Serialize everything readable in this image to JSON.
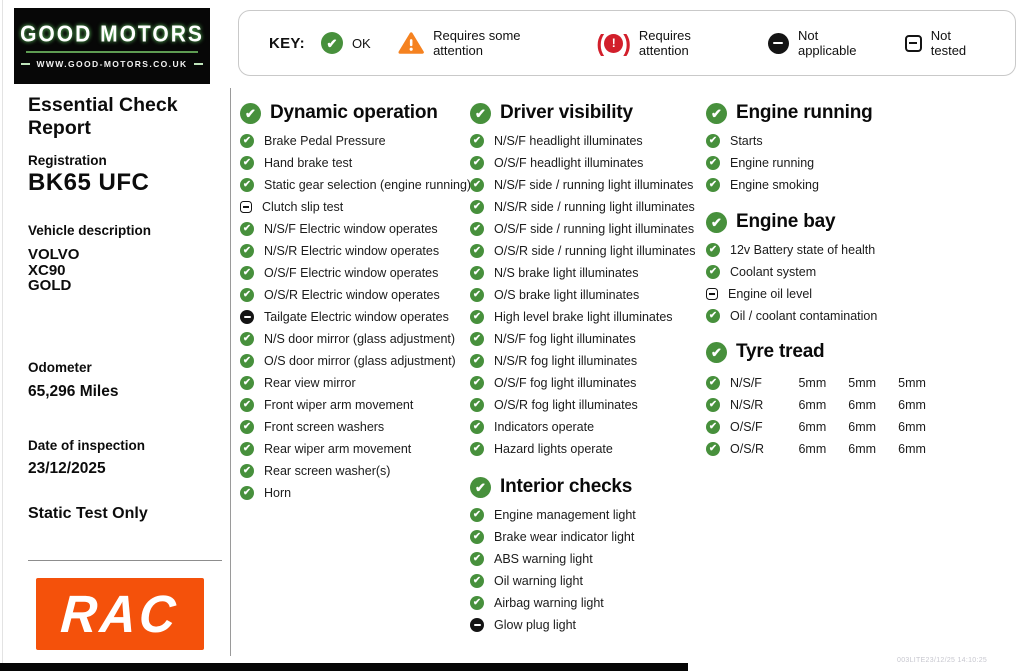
{
  "logo": {
    "title": "GOOD MOTORS",
    "url": "WWW.GOOD-MOTORS.CO.UK"
  },
  "key": {
    "label": "KEY:",
    "items": [
      {
        "icon": "ok-icon",
        "label": "OK"
      },
      {
        "icon": "warning-triangle-icon",
        "label": "Requires some attention"
      },
      {
        "icon": "brake-warning-icon",
        "label": "Requires attention"
      },
      {
        "icon": "not-applicable-icon",
        "label": "Not applicable"
      },
      {
        "icon": "not-tested-icon",
        "label": "Not tested"
      }
    ]
  },
  "sidebar": {
    "report_title": "Essential Check Report",
    "registration_label": "Registration",
    "registration_value": "BK65 UFC",
    "vehicle_label": "Vehicle description",
    "vehicle_lines": [
      "VOLVO",
      "XC90",
      "GOLD"
    ],
    "odometer_label": "Odometer",
    "odometer_value": "65,296 Miles",
    "inspection_label": "Date of inspection",
    "inspection_value": "23/12/2025",
    "test_type": "Static Test Only",
    "rac_logo_text": "RAC"
  },
  "columns": {
    "dynamic_operation": {
      "title": "Dynamic operation",
      "status": "ok",
      "items": [
        {
          "label": "Brake Pedal Pressure",
          "status": "ok"
        },
        {
          "label": "Hand brake test",
          "status": "ok"
        },
        {
          "label": "Static gear selection (engine running)",
          "status": "ok"
        },
        {
          "label": "Clutch slip test",
          "status": "not-tested"
        },
        {
          "label": "N/S/F Electric window operates",
          "status": "ok"
        },
        {
          "label": "N/S/R Electric window operates",
          "status": "ok"
        },
        {
          "label": "O/S/F Electric window operates",
          "status": "ok"
        },
        {
          "label": "O/S/R Electric window operates",
          "status": "ok"
        },
        {
          "label": "Tailgate Electric window operates",
          "status": "not-applicable"
        },
        {
          "label": "N/S door mirror (glass adjustment)",
          "status": "ok"
        },
        {
          "label": "O/S door mirror (glass adjustment)",
          "status": "ok"
        },
        {
          "label": "Rear view mirror",
          "status": "ok"
        },
        {
          "label": "Front wiper arm movement",
          "status": "ok"
        },
        {
          "label": "Front screen washers",
          "status": "ok"
        },
        {
          "label": "Rear wiper arm movement",
          "status": "ok"
        },
        {
          "label": "Rear screen washer(s)",
          "status": "ok"
        },
        {
          "label": "Horn",
          "status": "ok"
        }
      ]
    },
    "driver_visibility": {
      "title": "Driver visibility",
      "status": "ok",
      "items": [
        {
          "label": "N/S/F headlight illuminates",
          "status": "ok"
        },
        {
          "label": "O/S/F headlight illuminates",
          "status": "ok"
        },
        {
          "label": "N/S/F side / running light illuminates",
          "status": "ok"
        },
        {
          "label": "N/S/R side / running light illuminates",
          "status": "ok"
        },
        {
          "label": "O/S/F side / running light illuminates",
          "status": "ok"
        },
        {
          "label": "O/S/R side / running light illuminates",
          "status": "ok"
        },
        {
          "label": "N/S brake light illuminates",
          "status": "ok"
        },
        {
          "label": "O/S brake light illuminates",
          "status": "ok"
        },
        {
          "label": "High level brake light illuminates",
          "status": "ok"
        },
        {
          "label": "N/S/F fog light illuminates",
          "status": "ok"
        },
        {
          "label": "N/S/R fog light illuminates",
          "status": "ok"
        },
        {
          "label": "O/S/F fog light illuminates",
          "status": "ok"
        },
        {
          "label": "O/S/R fog light illuminates",
          "status": "ok"
        },
        {
          "label": "Indicators operate",
          "status": "ok"
        },
        {
          "label": "Hazard lights operate",
          "status": "ok"
        }
      ]
    },
    "interior_checks": {
      "title": "Interior checks",
      "status": "ok",
      "items": [
        {
          "label": "Engine management light",
          "status": "ok"
        },
        {
          "label": "Brake wear indicator light",
          "status": "ok"
        },
        {
          "label": "ABS warning light",
          "status": "ok"
        },
        {
          "label": "Oil warning light",
          "status": "ok"
        },
        {
          "label": "Airbag warning light",
          "status": "ok"
        },
        {
          "label": "Glow plug light",
          "status": "not-applicable"
        }
      ]
    },
    "engine_running": {
      "title": "Engine running",
      "status": "ok",
      "items": [
        {
          "label": "Starts",
          "status": "ok"
        },
        {
          "label": "Engine running",
          "status": "ok"
        },
        {
          "label": "Engine smoking",
          "status": "ok"
        }
      ]
    },
    "engine_bay": {
      "title": "Engine bay",
      "status": "ok",
      "items": [
        {
          "label": "12v Battery state of health",
          "status": "ok"
        },
        {
          "label": "Coolant system",
          "status": "ok"
        },
        {
          "label": "Engine oil level",
          "status": "not-tested"
        },
        {
          "label": "Oil / coolant contamination",
          "status": "ok"
        }
      ]
    },
    "tyre_tread": {
      "title": "Tyre tread",
      "status": "ok",
      "rows": [
        {
          "label": "N/S/F",
          "status": "ok",
          "values": [
            "5mm",
            "5mm",
            "5mm"
          ]
        },
        {
          "label": "N/S/R",
          "status": "ok",
          "values": [
            "6mm",
            "6mm",
            "6mm"
          ]
        },
        {
          "label": "O/S/F",
          "status": "ok",
          "values": [
            "6mm",
            "6mm",
            "6mm"
          ]
        },
        {
          "label": "O/S/R",
          "status": "ok",
          "values": [
            "6mm",
            "6mm",
            "6mm"
          ]
        }
      ]
    }
  },
  "footer": {
    "stamp": "003LITE23/12/25 14:10:25"
  },
  "colors": {
    "ok_green": "#47903c",
    "warn_orange": "#f58220",
    "alert_red": "#d21f2b",
    "na_black": "#141414",
    "rac_orange": "#f4510b",
    "logo_green": "#5e9c52"
  }
}
